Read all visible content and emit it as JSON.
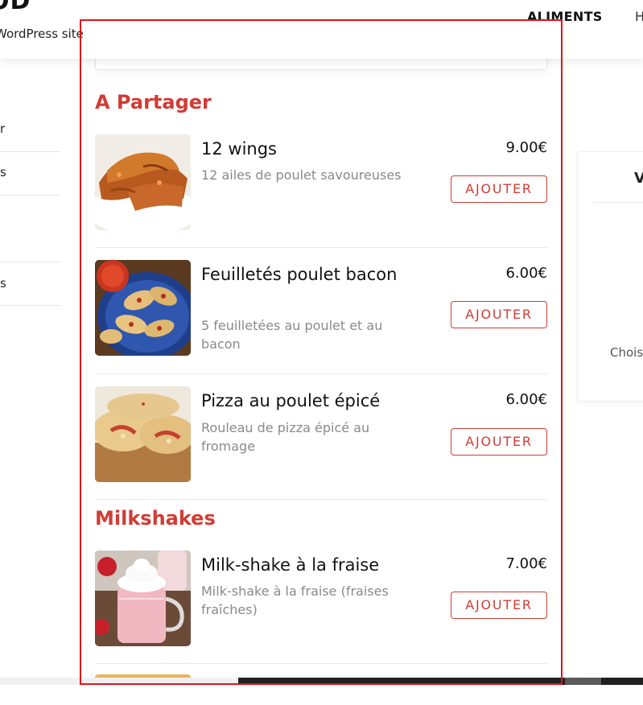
{
  "header": {
    "site_title": "OD",
    "tagline": "WordPress site",
    "nav": [
      "ALIMENTS",
      "H"
    ]
  },
  "sidebar": {
    "items": [
      "r",
      "s",
      "s"
    ]
  },
  "right_card": {
    "title": "V",
    "text": "Chois"
  },
  "menu": {
    "sections": [
      {
        "title": "A Partager",
        "items": [
          {
            "name": "12 wings",
            "desc": "12 ailes de poulet savoureuses",
            "price": "9.00€",
            "button": "AJOUTER",
            "image": "wings-image"
          },
          {
            "name": "Feuilletés poulet bacon",
            "desc": "5 feuilletées au poulet et au bacon",
            "price": "6.00€",
            "button": "AJOUTER",
            "image": "puff-pastry-image"
          },
          {
            "name": "Pizza au poulet épicé",
            "desc": "Rouleau de pizza épicé au fromage",
            "price": "6.00€",
            "button": "AJOUTER",
            "image": "pizza-roll-image"
          }
        ]
      },
      {
        "title": "Milkshakes",
        "items": [
          {
            "name": "Milk-shake à la fraise",
            "desc": "Milk-shake à la fraise (fraises fraîches)",
            "price": "7.00€",
            "button": "AJOUTER",
            "image": "strawberry-milkshake-image"
          }
        ]
      }
    ]
  },
  "colors": {
    "accent": "#d03c36",
    "selection": "#e0141a"
  }
}
